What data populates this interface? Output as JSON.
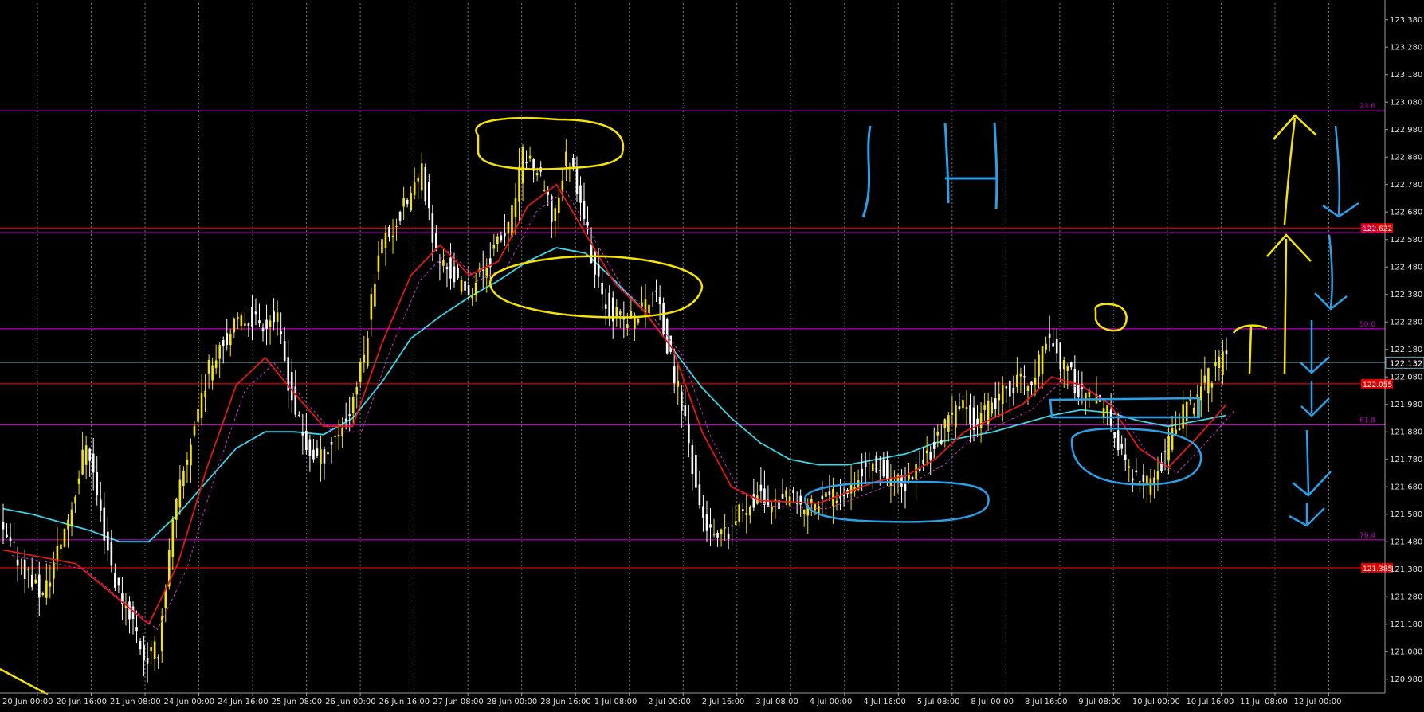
{
  "chart_data": {
    "type": "candlestick",
    "timeframe_label": "1H",
    "x_ticks": [
      "20 Jun 00:00",
      "20 Jun 16:00",
      "21 Jun 08:00",
      "24 Jun 00:00",
      "24 Jun 16:00",
      "25 Jun 08:00",
      "26 Jun 00:00",
      "26 Jun 16:00",
      "27 Jun 08:00",
      "28 Jun 00:00",
      "28 Jun 16:00",
      "1 Jul 08:00",
      "2 Jul 00:00",
      "2 Jul 16:00",
      "3 Jul 08:00",
      "4 Jul 00:00",
      "4 Jul 16:00",
      "5 Jul 08:00",
      "8 Jul 00:00",
      "8 Jul 16:00",
      "9 Jul 08:00",
      "10 Jul 00:00",
      "10 Jul 16:00",
      "11 Jul 08:00",
      "12 Jul 00:00"
    ],
    "y_ticks": [
      123.38,
      123.28,
      123.18,
      123.08,
      122.98,
      122.88,
      122.78,
      122.68,
      122.58,
      122.48,
      122.38,
      122.28,
      122.18,
      122.08,
      121.98,
      121.88,
      121.78,
      121.68,
      121.58,
      121.48,
      121.38,
      121.28,
      121.18,
      121.08,
      120.98
    ],
    "y_tick_labels": [
      "123.380",
      "123.280",
      "123.180",
      "123.080",
      "122.980",
      "122.880",
      "122.780",
      "122.680",
      "122.580",
      "122.480",
      "122.380",
      "122.280",
      "122.180",
      "122.080",
      "121.980",
      "121.880",
      "121.780",
      "121.680",
      "121.580",
      "121.480",
      "121.380",
      "121.280",
      "121.180",
      "121.080",
      "120.980"
    ],
    "ylim": [
      120.93,
      123.44
    ],
    "current_price": {
      "value": 122.132,
      "label": "122.132"
    },
    "horizontal_levels": [
      {
        "value": 123.048,
        "label": "23.6",
        "color": "#c000c0"
      },
      {
        "value": 122.622,
        "label": "122.622",
        "color": "#e00000",
        "badge": true
      },
      {
        "value": 122.605,
        "label": "38.2",
        "color": "#c000c0"
      },
      {
        "value": 122.255,
        "label": "50.0",
        "color": "#c000c0"
      },
      {
        "value": 122.055,
        "label": "122.055",
        "color": "#e00000",
        "badge": true
      },
      {
        "value": 121.905,
        "label": "61.8",
        "color": "#c000c0"
      },
      {
        "value": 121.487,
        "label": "76.4",
        "color": "#c000c0"
      },
      {
        "value": 121.385,
        "label": "121.385",
        "color": "#e00000",
        "badge": true
      }
    ],
    "price_path": [
      [
        0,
        121.52
      ],
      [
        3,
        121.28
      ],
      [
        5,
        121.62
      ],
      [
        6,
        121.86
      ],
      [
        7,
        121.56
      ],
      [
        8,
        121.32
      ],
      [
        9,
        121.22
      ],
      [
        10,
        121.05
      ],
      [
        11,
        121.1
      ],
      [
        11.2,
        121.25
      ],
      [
        12,
        121.58
      ],
      [
        13,
        121.82
      ],
      [
        14,
        122.05
      ],
      [
        15,
        122.2
      ],
      [
        16,
        122.25
      ],
      [
        17,
        122.3
      ],
      [
        18,
        122.28
      ],
      [
        19,
        122.3
      ],
      [
        20,
        122.02
      ],
      [
        21,
        121.82
      ],
      [
        22,
        121.78
      ],
      [
        23,
        121.86
      ],
      [
        24,
        121.95
      ],
      [
        25,
        122.15
      ],
      [
        26,
        122.55
      ],
      [
        27,
        122.62
      ],
      [
        28,
        122.72
      ],
      [
        29,
        122.82
      ],
      [
        30,
        122.52
      ],
      [
        31,
        122.46
      ],
      [
        32,
        122.38
      ],
      [
        33,
        122.45
      ],
      [
        34,
        122.55
      ],
      [
        35,
        122.62
      ],
      [
        36,
        122.9
      ],
      [
        37,
        122.82
      ],
      [
        38,
        122.65
      ],
      [
        39,
        122.9
      ],
      [
        40,
        122.72
      ],
      [
        41,
        122.42
      ],
      [
        42,
        122.32
      ],
      [
        43,
        122.28
      ],
      [
        44,
        122.32
      ],
      [
        45,
        122.4
      ],
      [
        46,
        122.15
      ],
      [
        47,
        121.95
      ],
      [
        48,
        121.62
      ],
      [
        49,
        121.48
      ],
      [
        50,
        121.5
      ],
      [
        51,
        121.6
      ],
      [
        52,
        121.65
      ],
      [
        53,
        121.62
      ],
      [
        54,
        121.64
      ],
      [
        55,
        121.6
      ],
      [
        56,
        121.62
      ],
      [
        57,
        121.64
      ],
      [
        58,
        121.68
      ],
      [
        59,
        121.72
      ],
      [
        60,
        121.78
      ],
      [
        61,
        121.72
      ],
      [
        62,
        121.67
      ],
      [
        63,
        121.75
      ],
      [
        64,
        121.82
      ],
      [
        65,
        121.9
      ],
      [
        66,
        121.98
      ],
      [
        67,
        121.92
      ],
      [
        68,
        121.96
      ],
      [
        69,
        122.02
      ],
      [
        70,
        122.07
      ],
      [
        71,
        122.05
      ],
      [
        72,
        122.25
      ],
      [
        73,
        122.12
      ],
      [
        74,
        122.05
      ],
      [
        75,
        122.0
      ],
      [
        76,
        121.95
      ],
      [
        77,
        121.8
      ],
      [
        78,
        121.7
      ],
      [
        79,
        121.68
      ],
      [
        80,
        121.8
      ],
      [
        81,
        121.92
      ],
      [
        82,
        122.0
      ],
      [
        83,
        122.08
      ],
      [
        84,
        122.14
      ]
    ],
    "ma_fast": [
      [
        0,
        121.45
      ],
      [
        5,
        121.4
      ],
      [
        10,
        121.18
      ],
      [
        12,
        121.4
      ],
      [
        14,
        121.75
      ],
      [
        16,
        122.05
      ],
      [
        18,
        122.15
      ],
      [
        20,
        122.02
      ],
      [
        22,
        121.9
      ],
      [
        24,
        121.9
      ],
      [
        26,
        122.2
      ],
      [
        28,
        122.45
      ],
      [
        30,
        122.56
      ],
      [
        32,
        122.45
      ],
      [
        34,
        122.5
      ],
      [
        36,
        122.7
      ],
      [
        38,
        122.78
      ],
      [
        40,
        122.6
      ],
      [
        42,
        122.42
      ],
      [
        44,
        122.32
      ],
      [
        46,
        122.18
      ],
      [
        48,
        121.88
      ],
      [
        50,
        121.68
      ],
      [
        52,
        121.63
      ],
      [
        56,
        121.62
      ],
      [
        60,
        121.7
      ],
      [
        62,
        121.72
      ],
      [
        64,
        121.78
      ],
      [
        66,
        121.88
      ],
      [
        68,
        121.93
      ],
      [
        70,
        121.98
      ],
      [
        72,
        122.08
      ],
      [
        74,
        122.05
      ],
      [
        76,
        121.98
      ],
      [
        78,
        121.82
      ],
      [
        80,
        121.75
      ],
      [
        82,
        121.86
      ],
      [
        84,
        121.98
      ]
    ],
    "ma_slow": [
      [
        0,
        121.6
      ],
      [
        2,
        121.58
      ],
      [
        4,
        121.55
      ],
      [
        6,
        121.52
      ],
      [
        8,
        121.48
      ],
      [
        10,
        121.48
      ],
      [
        12,
        121.58
      ],
      [
        14,
        121.7
      ],
      [
        16,
        121.82
      ],
      [
        18,
        121.88
      ],
      [
        20,
        121.88
      ],
      [
        22,
        121.87
      ],
      [
        24,
        121.93
      ],
      [
        26,
        122.06
      ],
      [
        28,
        122.22
      ],
      [
        30,
        122.3
      ],
      [
        32,
        122.37
      ],
      [
        34,
        122.43
      ],
      [
        36,
        122.5
      ],
      [
        38,
        122.55
      ],
      [
        40,
        122.53
      ],
      [
        42,
        122.43
      ],
      [
        44,
        122.32
      ],
      [
        46,
        122.18
      ],
      [
        48,
        122.04
      ],
      [
        50,
        121.93
      ],
      [
        52,
        121.84
      ],
      [
        54,
        121.78
      ],
      [
        56,
        121.76
      ],
      [
        58,
        121.76
      ],
      [
        60,
        121.78
      ],
      [
        62,
        121.8
      ],
      [
        64,
        121.84
      ],
      [
        66,
        121.86
      ],
      [
        68,
        121.88
      ],
      [
        70,
        121.91
      ],
      [
        72,
        121.94
      ],
      [
        74,
        121.96
      ],
      [
        76,
        121.95
      ],
      [
        78,
        121.92
      ],
      [
        80,
        121.9
      ],
      [
        82,
        121.92
      ],
      [
        84,
        121.94
      ]
    ]
  }
}
